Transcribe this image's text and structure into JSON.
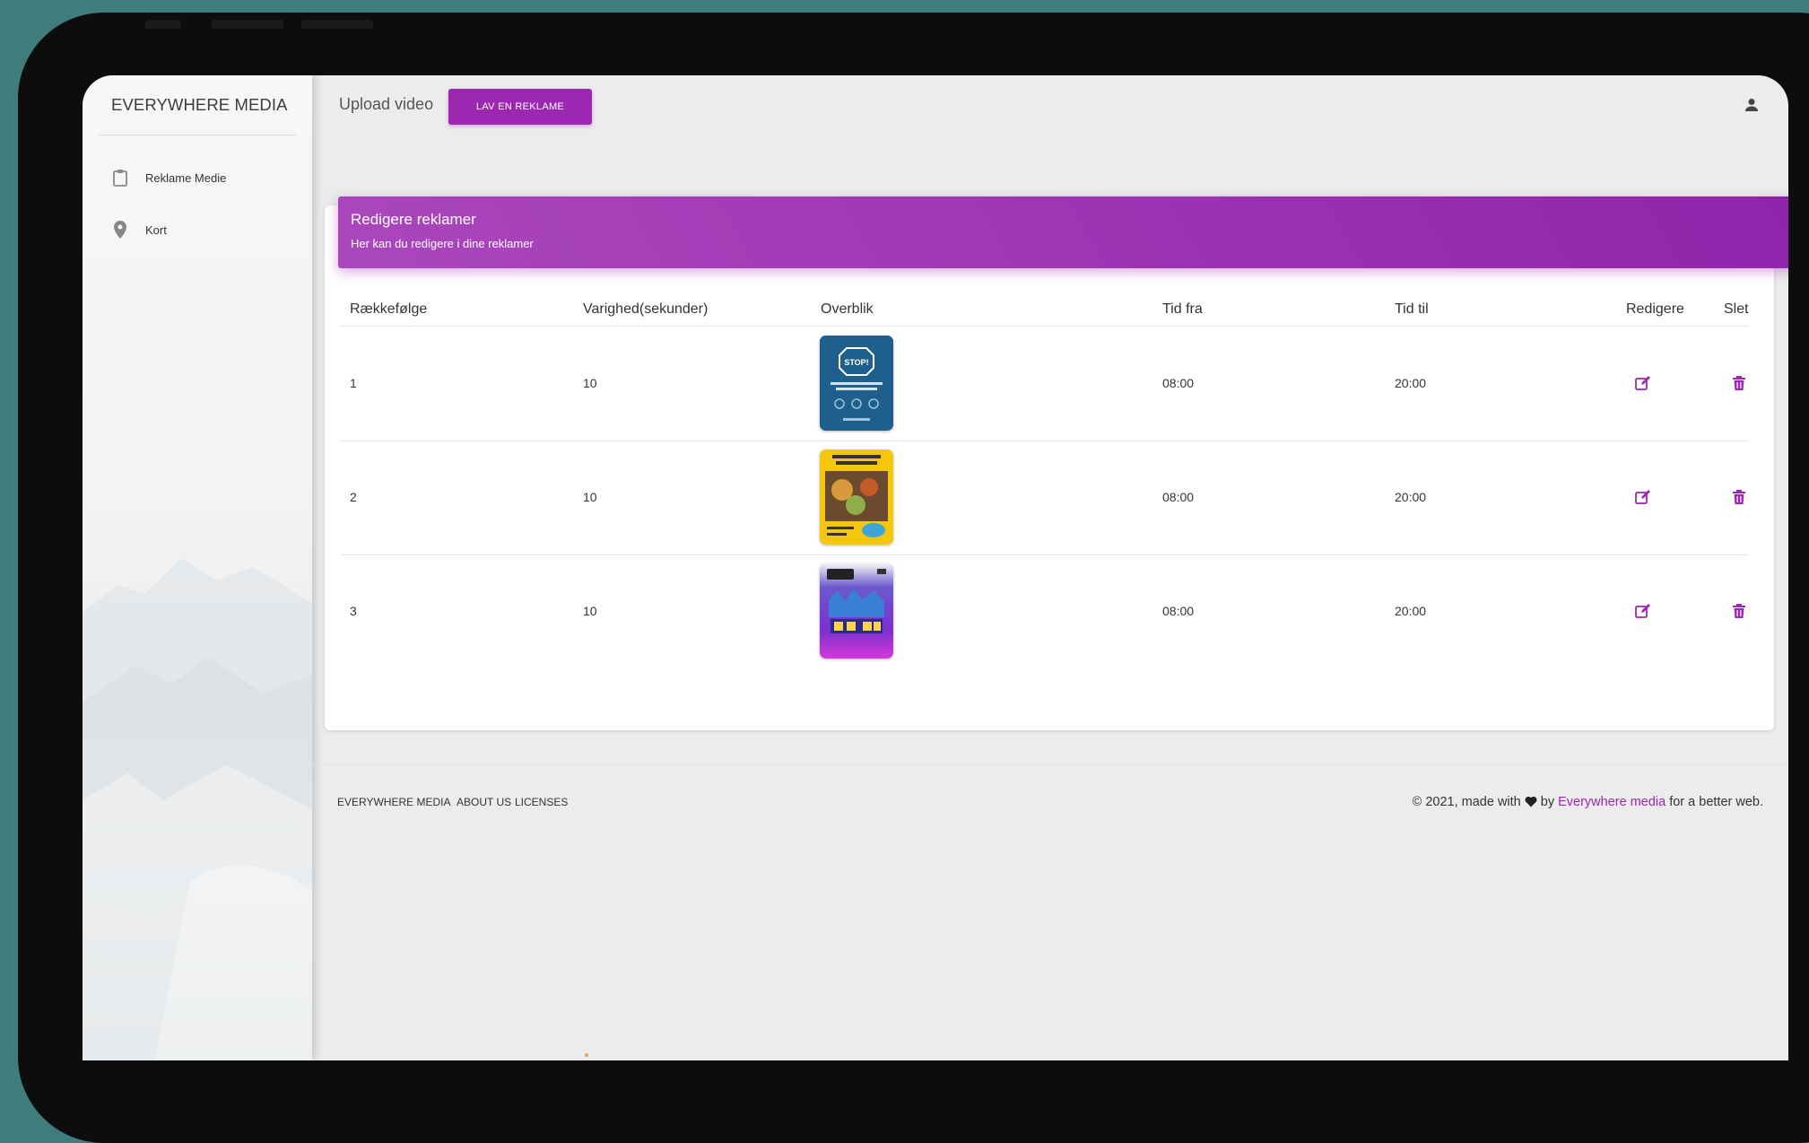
{
  "sidebar": {
    "brand": "EVERYWHERE MEDIA",
    "items": [
      {
        "label": "Reklame Medie",
        "icon": "clipboard-icon"
      },
      {
        "label": "Kort",
        "icon": "location-pin-icon"
      }
    ]
  },
  "topbar": {
    "title": "Upload video",
    "button_label": "LAV EN REKLAME",
    "user_icon": "person-icon"
  },
  "card": {
    "title": "Redigere reklamer",
    "subtitle": "Her kan du redigere i dine reklamer"
  },
  "table": {
    "headers": [
      "Rækkefølge",
      "Varighed(sekunder)",
      "Overblik",
      "Tid fra",
      "Tid til",
      "Redigere",
      "Slet"
    ],
    "rows": [
      {
        "order": "1",
        "duration": "10",
        "from": "08:00",
        "to": "20:00"
      },
      {
        "order": "2",
        "duration": "10",
        "from": "08:00",
        "to": "20:00"
      },
      {
        "order": "3",
        "duration": "10",
        "from": "08:00",
        "to": "20:00"
      }
    ],
    "thumbnail_text": {
      "stop": "STOP!"
    }
  },
  "footer": {
    "links": [
      "EVERYWHERE MEDIA",
      "ABOUT US",
      "LICENSES"
    ],
    "copy_prefix": "© 2021, made with",
    "copy_by": "by",
    "copy_link": "Everywhere media",
    "copy_suffix": "for a better web."
  },
  "colors": {
    "accent": "#9c27b0",
    "background": "#3f7c7c",
    "device": "#0d0d0d"
  }
}
